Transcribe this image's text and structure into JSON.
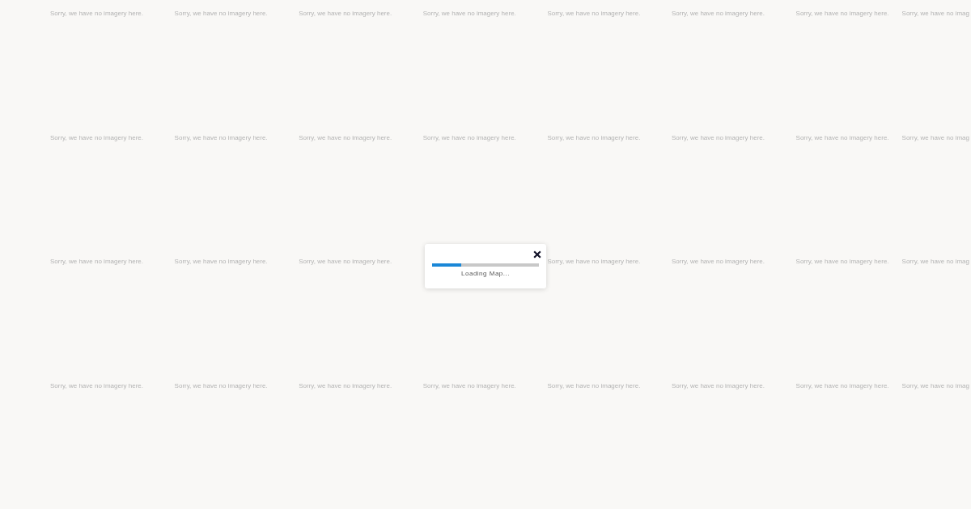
{
  "map": {
    "tile_rows": [
      {
        "tiles": [
          {
            "message": "Sorry, we have no imagery here."
          },
          {
            "message": "Sorry, we have no imagery here."
          },
          {
            "message": "Sorry, we have no imagery here."
          },
          {
            "message": "Sorry, we have no imagery here."
          },
          {
            "message": "Sorry, we have no imagery here."
          },
          {
            "message": "Sorry, we have no imagery here."
          },
          {
            "message": "Sorry, we have no imagery here."
          },
          {
            "message": "Sorry, we have no imag"
          }
        ]
      },
      {
        "tiles": [
          {
            "message": "Sorry, we have no imagery here."
          },
          {
            "message": "Sorry, we have no imagery here."
          },
          {
            "message": "Sorry, we have no imagery here."
          },
          {
            "message": "Sorry, we have no imagery here."
          },
          {
            "message": "Sorry, we have no imagery here."
          },
          {
            "message": "Sorry, we have no imagery here."
          },
          {
            "message": "Sorry, we have no imagery here."
          },
          {
            "message": "Sorry, we have no imag"
          }
        ]
      },
      {
        "tiles_left_of_dialog": [
          {
            "message": "Sorry, we have no imagery here."
          },
          {
            "message": "Sorry, we have no imagery here."
          },
          {
            "message": "Sorry, we have no imagery here."
          }
        ],
        "tiles_right_of_dialog": [
          {
            "message": "Sorry, we have no imagery here."
          },
          {
            "message": "Sorry, we have no imagery here."
          },
          {
            "message": "Sorry, we have no imagery here."
          },
          {
            "message": "Sorry, we have no imag"
          }
        ]
      },
      {
        "tiles": [
          {
            "message": "Sorry, we have no imagery here."
          },
          {
            "message": "Sorry, we have no imagery here."
          },
          {
            "message": "Sorry, we have no imagery here."
          },
          {
            "message": "Sorry, we have no imagery here."
          },
          {
            "message": "Sorry, we have no imagery here."
          },
          {
            "message": "Sorry, we have no imagery here."
          },
          {
            "message": "Sorry, we have no imagery here."
          },
          {
            "message": "Sorry, we have no imag"
          }
        ]
      }
    ]
  },
  "loading_dialog": {
    "progress": {
      "level": 0.27
    },
    "message": "Loading Map..."
  }
}
